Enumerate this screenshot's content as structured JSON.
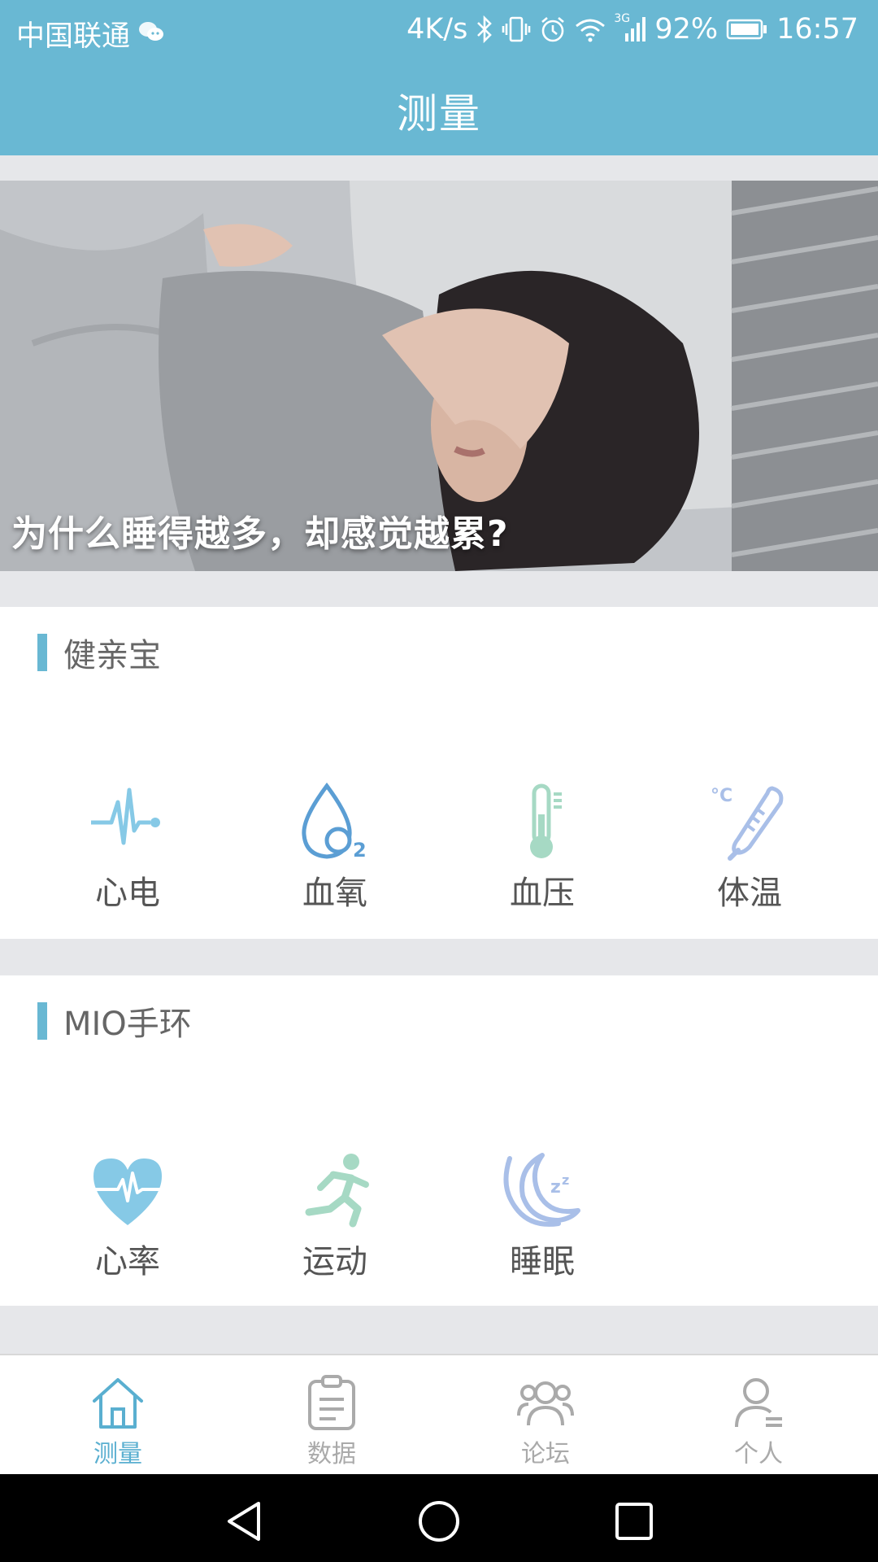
{
  "status_bar": {
    "carrier": "中国联通",
    "speed": "4K/s",
    "network": "3G",
    "battery": "92%",
    "time": "16:57"
  },
  "app_bar": {
    "title": "测量"
  },
  "banner": {
    "caption": "为什么睡得越多，却感觉越累?"
  },
  "sections": [
    {
      "title": "健亲宝",
      "items": [
        {
          "label": "心电",
          "icon": "ecg-icon"
        },
        {
          "label": "血氧",
          "icon": "oxygen-drop-icon"
        },
        {
          "label": "血压",
          "icon": "thermometer-icon"
        },
        {
          "label": "体温",
          "icon": "temperature-icon"
        }
      ]
    },
    {
      "title": "MIO手环",
      "items": [
        {
          "label": "心率",
          "icon": "heart-rate-icon"
        },
        {
          "label": "运动",
          "icon": "runner-icon"
        },
        {
          "label": "睡眠",
          "icon": "moon-sleep-icon"
        }
      ]
    }
  ],
  "bottom_nav": {
    "items": [
      {
        "label": "测量",
        "icon": "home-icon",
        "active": true
      },
      {
        "label": "数据",
        "icon": "clipboard-icon",
        "active": false
      },
      {
        "label": "论坛",
        "icon": "people-icon",
        "active": false
      },
      {
        "label": "个人",
        "icon": "person-icon",
        "active": false
      }
    ]
  },
  "colors": {
    "accent": "#69b8d3",
    "nav_active": "#5aafd0",
    "nav_inactive": "#aaaaaa",
    "icon_blue": "#86c9e6",
    "icon_green": "#a6d9c4",
    "icon_purple": "#a9bfe8"
  }
}
